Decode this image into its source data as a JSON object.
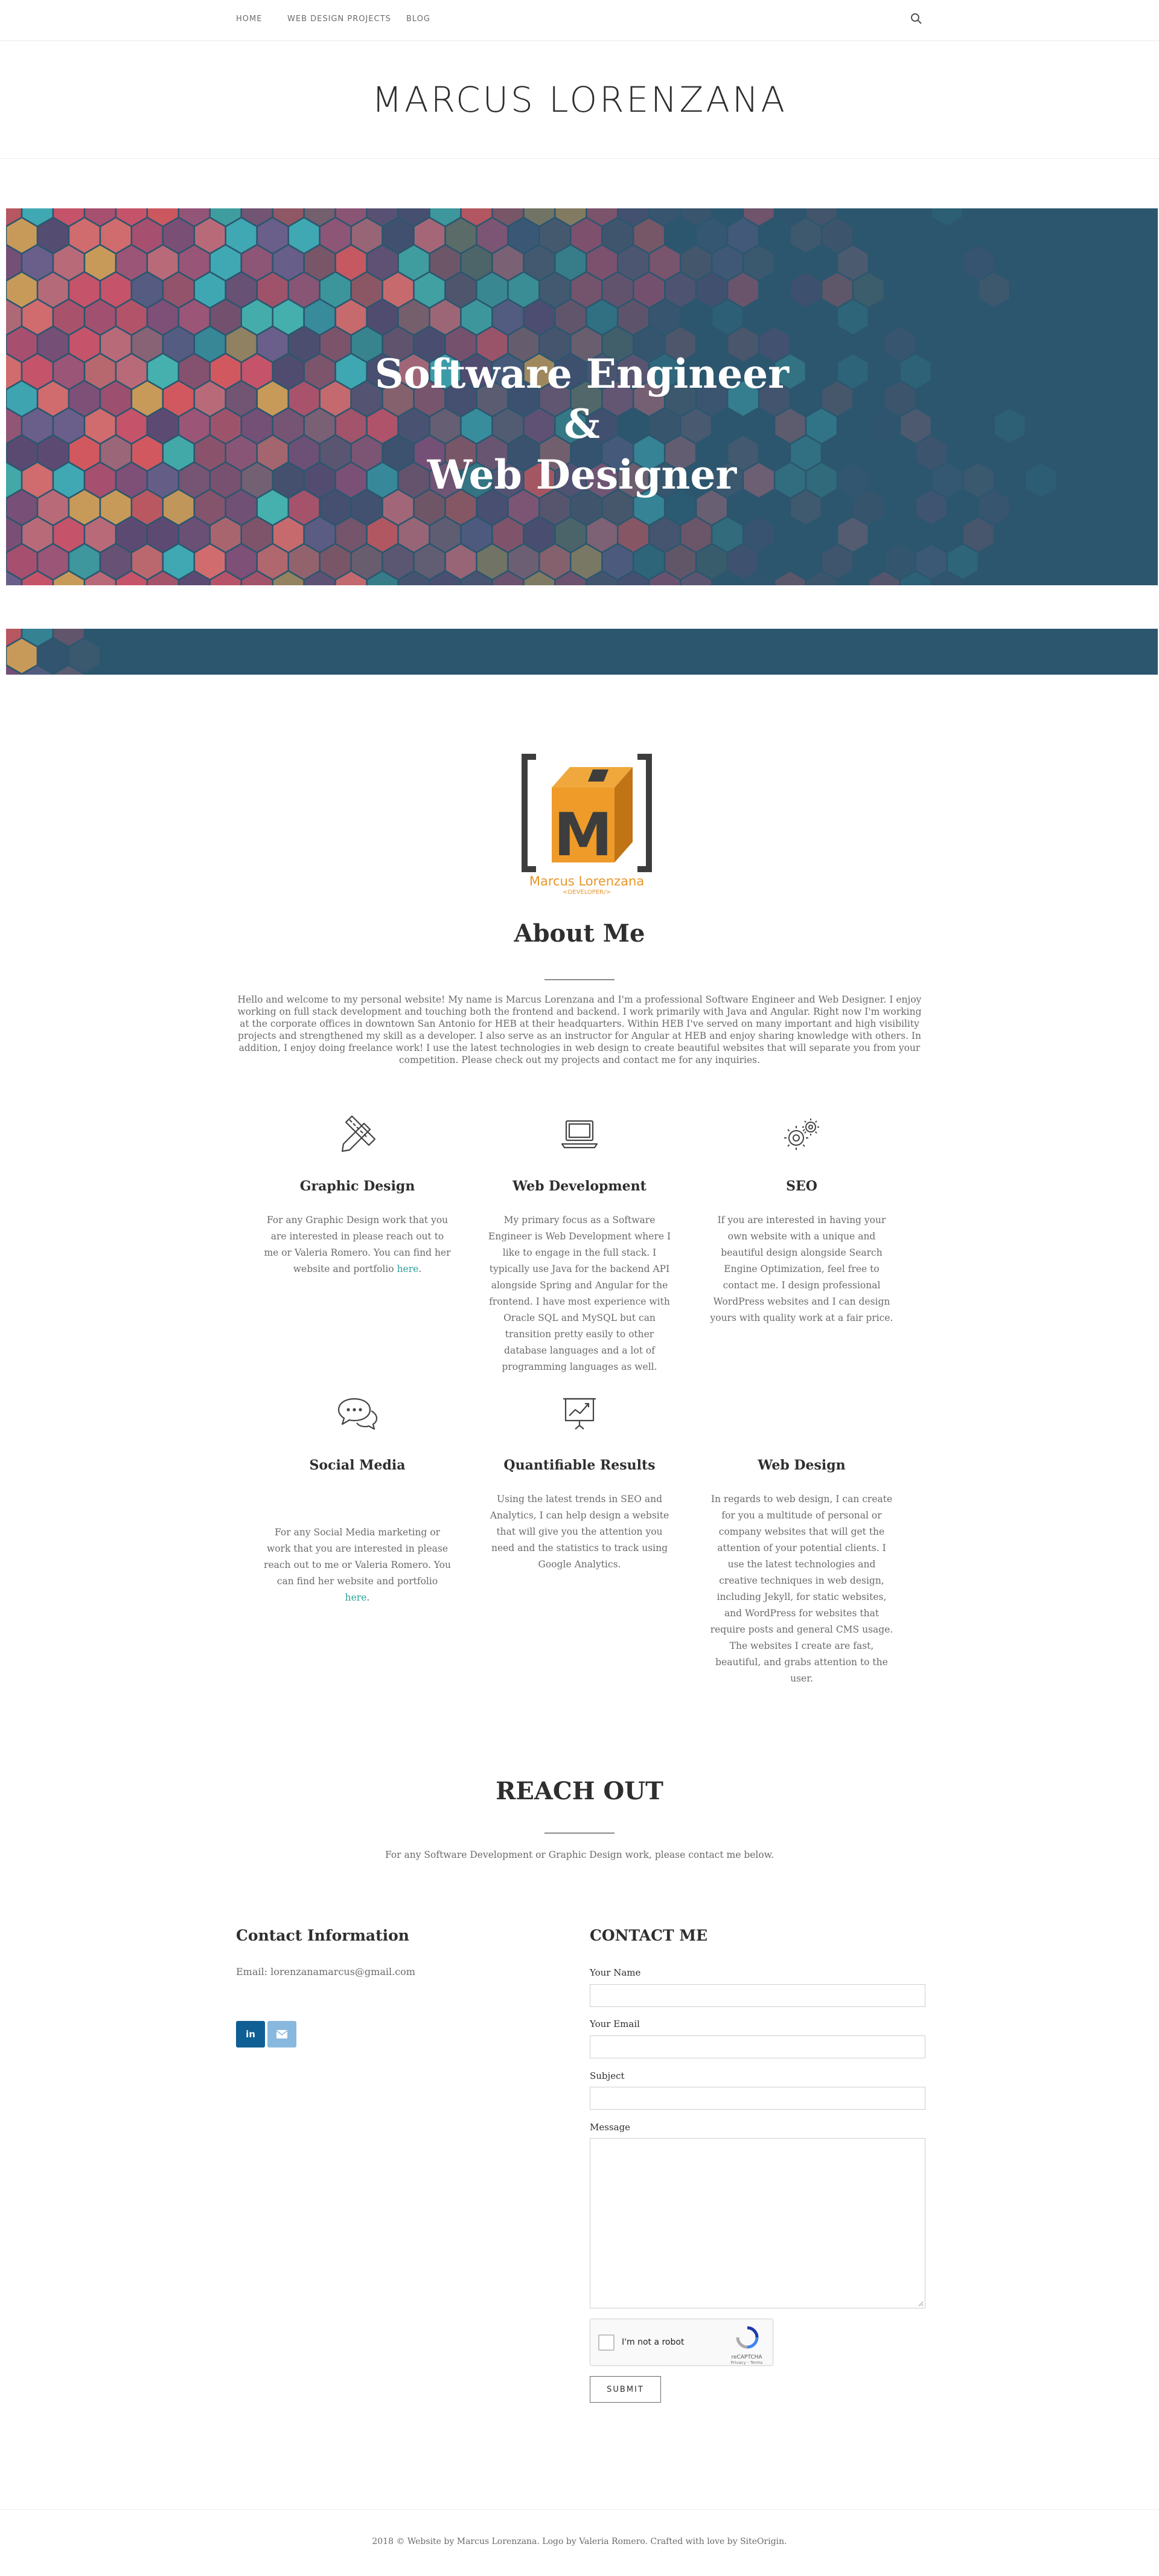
{
  "nav": {
    "items": [
      "HOME",
      "WEB DESIGN PROJECTS",
      "BLOG"
    ],
    "search_icon": "search-icon"
  },
  "header": {
    "title": "MARCUS LORENZANA"
  },
  "hero": {
    "line1": "Software Engineer",
    "line2": "&",
    "line3": "Web Designer",
    "bg_color": "#2b566e"
  },
  "about": {
    "logo_name": "Marcus Lorenzana",
    "logo_tag": "<DEVELOPER/>",
    "logo_letter": "M",
    "title": "About Me",
    "text": "Hello and welcome to my personal website! My name is Marcus Lorenzana and I'm a professional Software Engineer and Web Designer. I enjoy working on full stack development and touching both the frontend and backend. I work primarily with Java and Angular. Right now I'm working at the corporate offices in downtown San Antonio for HEB at their headquarters. Within HEB I've served on many important and high visibility projects and strengthened my skill as a developer. I also serve as an instructor for Angular at HEB and enjoy sharing knowledge with others. In addition, I enjoy doing freelance work! I use the latest technologies in web design to create beautiful websites that will separate you from your competition. Please check out my projects and contact me for any inquiries."
  },
  "features": [
    {
      "icon": "pencil-ruler-icon",
      "title": "Graphic Design",
      "text": "For any Graphic Design work that you are interested in please reach out to me or Valeria Romero. You can find her website and portfolio ",
      "link": "here",
      "after": "."
    },
    {
      "icon": "laptop-icon",
      "title": "Web Development",
      "text": "My primary focus as a Software Engineer is Web Development where I like to engage in the full stack. I typically use Java for the backend API alongside Spring and Angular for the frontend. I have most experience with Oracle SQL and MySQL but can transition pretty easily to other database languages and a lot of programming languages as well."
    },
    {
      "icon": "gears-icon",
      "title": "SEO",
      "text": "If you are interested in having your own website with a unique and beautiful design alongside Search Engine Optimization, feel free to contact me. I design professional WordPress websites and I can design yours with quality work at a fair price."
    },
    {
      "icon": "speech-bubbles-icon",
      "title": "Social Media",
      "text": "For any Social Media marketing or work that you are interested in please reach out to me or Valeria Romero. You can find her website and portfolio ",
      "link": "here",
      "after": "."
    },
    {
      "icon": "chart-board-icon",
      "title": "Quantifiable Results",
      "text": "Using the latest trends in SEO and Analytics, I can help design a website that will give you the attention you need and the statistics to track using Google Analytics."
    },
    {
      "icon": "web-design-icon",
      "title": "Web Design",
      "text": "In regards to web design, I can create for you a multitude of personal or company websites that will get the attention of your potential clients. I use the latest technologies and creative techniques in web design, including Jekyll, for static websites, and WordPress for websites that require posts and general CMS usage. The websites I create are fast, beautiful, and grabs attention to the user."
    }
  ],
  "reach": {
    "title": "REACH OUT",
    "subtitle": "For any Software Development or Graphic Design work, please contact me below."
  },
  "contact": {
    "info_title": "Contact Information",
    "email_line": "Email: lorenzanamarcus@gmail.com",
    "linkedin_label": "in",
    "linkedin_color": "#0f5f94",
    "mail_color": "#89b8de"
  },
  "form": {
    "title": "CONTACT ME",
    "name_label": "Your Name",
    "email_label": "Your Email",
    "subject_label": "Subject",
    "message_label": "Message",
    "recaptcha_label": "I'm not a robot",
    "recaptcha_brand": "reCAPTCHA",
    "recaptcha_links": "Privacy - Terms",
    "submit_label": "SUBMIT"
  },
  "footer": {
    "text": "2018 © Website by Marcus Lorenzana. Logo by Valeria Romero. Crafted with love by SiteOrigin."
  }
}
